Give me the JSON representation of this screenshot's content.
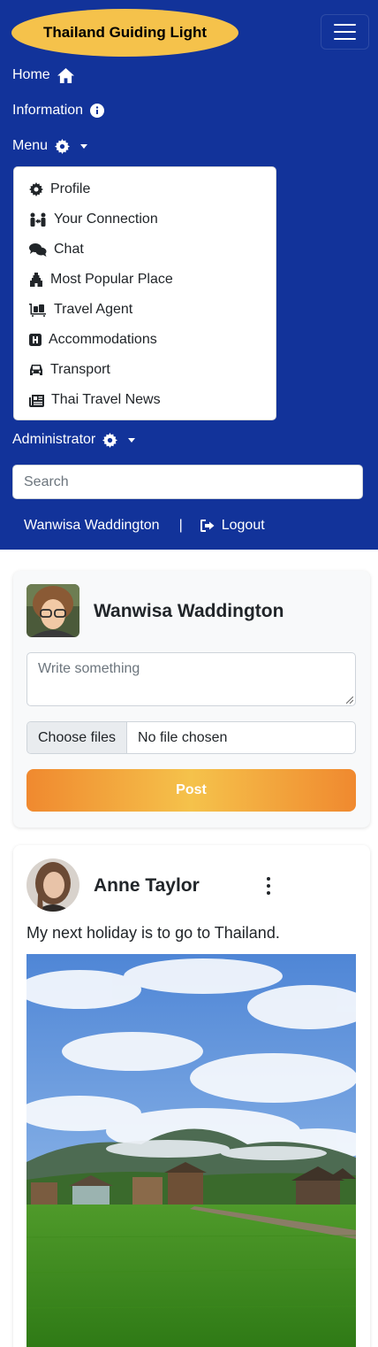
{
  "nav": {
    "brand": "Thailand Guiding Light",
    "home": "Home",
    "information": "Information",
    "menu": "Menu",
    "administrator": "Administrator",
    "search_placeholder": "Search",
    "user_name": "Wanwisa Waddington",
    "separator": "|",
    "logout": "Logout"
  },
  "menu_items": [
    {
      "label": "Profile",
      "icon": "gear-icon"
    },
    {
      "label": "Your Connection",
      "icon": "people-arrows-icon"
    },
    {
      "label": "Chat",
      "icon": "comments-icon"
    },
    {
      "label": "Most Popular Place",
      "icon": "gopuram-icon"
    },
    {
      "label": "Travel Agent",
      "icon": "luggage-cart-icon"
    },
    {
      "label": "Accommodations",
      "icon": "hotel-h-icon"
    },
    {
      "label": "Transport",
      "icon": "car-icon"
    },
    {
      "label": "Thai Travel News",
      "icon": "newspaper-icon"
    }
  ],
  "composer": {
    "user_name": "Wanwisa Waddington",
    "placeholder": "Write something",
    "choose_files": "Choose files",
    "file_status": "No file chosen",
    "post_button": "Post"
  },
  "post": {
    "author": "Anne Taylor",
    "text": "My next holiday is to go to Thailand."
  },
  "colors": {
    "nav_bg": "#12339a",
    "brand_bg": "#f5c24b",
    "post_gradient_edge": "#f0892f",
    "post_gradient_mid": "#f5c24b"
  }
}
